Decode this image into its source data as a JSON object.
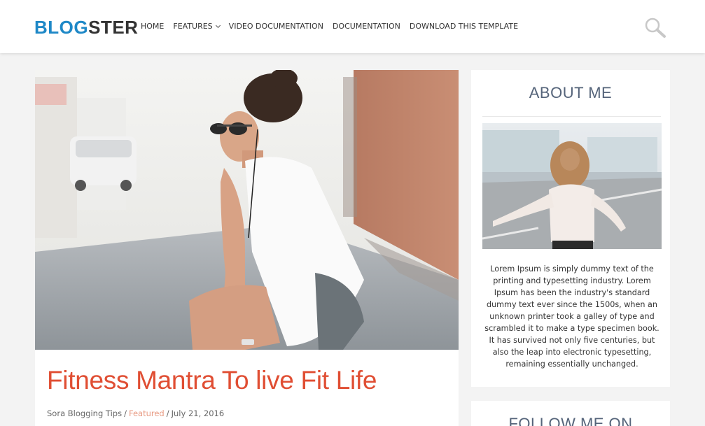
{
  "header": {
    "logo_part1": "BLOG",
    "logo_part2": "STER",
    "nav": [
      {
        "label": "HOME"
      },
      {
        "label": "FEATURES"
      },
      {
        "label": "VIDEO DOCUMENTATION"
      },
      {
        "label": "DOCUMENTATION"
      },
      {
        "label": "DOWNLOAD THIS TEMPLATE"
      }
    ],
    "search_icon": "search-icon"
  },
  "post": {
    "title": "Fitness Mantra To live Fit Life",
    "author": "Sora Blogging Tips",
    "category": "Featured",
    "date": "July 21, 2016",
    "separator": "/"
  },
  "sidebar": {
    "about": {
      "title": "ABOUT ME",
      "text": "Lorem Ipsum is simply dummy text of the printing and typesetting industry. Lorem Ipsum has been the industry's standard dummy text ever since the 1500s, when an unknown printer took a galley of type and scrambled it to make a type specimen book. It has survived not only five centuries, but also the leap into electronic typesetting, remaining essentially unchanged."
    },
    "follow": {
      "title": "FOLLOW ME ON"
    }
  },
  "colors": {
    "accent": "#1e88c7",
    "title": "#e04e33",
    "widget_title": "#55647a"
  }
}
